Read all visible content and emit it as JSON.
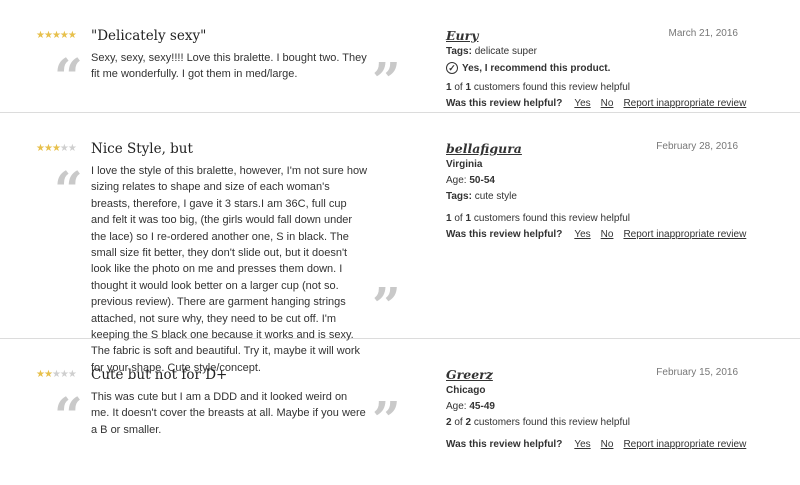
{
  "reviews": [
    {
      "rating": 5,
      "title": "\"Delicately sexy\"",
      "body": "Sexy, sexy, sexy!!!! Love this bralette. I bought two. They fit me wonderfully. I got them in med/large.",
      "author": "Eury",
      "date": "March 21, 2016",
      "tags_label": "Tags:",
      "tags": "delicate super",
      "recommend": "Yes, I recommend this product.",
      "helpful_count": "1",
      "helpful_of": "of",
      "helpful_total": "1",
      "helpful_suffix": "customers found this review helpful",
      "question": "Was this review helpful?",
      "yes": "Yes",
      "no": "No",
      "report": "Report inappropriate review"
    },
    {
      "rating": 3,
      "title": "Nice Style, but",
      "body": "I love the style of this bralette, however, I'm not sure how sizing relates to shape and size of each woman's breasts, therefore, I gave it 3 stars.I am 36C, full cup and felt it was too big, (the girls would fall down under the lace) so I re-ordered another one, S in black. The small size fit better, they don't slide out, but it doesn't look like the photo on me and presses them down. I thought it would look better on a larger cup (not so. previous review). There are garment hanging strings attached, not sure why, they need to be cut off. I'm keeping the S black one because it works and is sexy. The fabric is soft and beautiful. Try it, maybe it will work for your shape. Cute style/concept.",
      "author": "bellafigura",
      "date": "February 28, 2016",
      "location": "Virginia",
      "age_label": "Age:",
      "age": "50-54",
      "tags_label": "Tags:",
      "tags": "cute style",
      "helpful_count": "1",
      "helpful_of": "of",
      "helpful_total": "1",
      "helpful_suffix": "customers found this review helpful",
      "question": "Was this review helpful?",
      "yes": "Yes",
      "no": "No",
      "report": "Report inappropriate review"
    },
    {
      "rating": 2,
      "title": "Cute but not for D+",
      "body": "This was cute but I am a DDD and it looked weird on me. It doesn't cover the breasts at all. Maybe if you were a B or smaller.",
      "author": "Greerz",
      "date": "February 15, 2016",
      "location": "Chicago",
      "age_label": "Age:",
      "age": "45-49",
      "helpful_count": "2",
      "helpful_of": "of",
      "helpful_total": "2",
      "helpful_suffix": "customers found this review helpful",
      "question": "Was this review helpful?",
      "yes": "Yes",
      "no": "No",
      "report": "Report inappropriate review"
    }
  ],
  "colors": {
    "star_on": "#e7c04c",
    "star_off": "#cfcfcf",
    "quote": "#c9c9c9",
    "divider": "#dcdcdc"
  },
  "icons": {
    "star": "star-icon",
    "check": "check-circle-icon",
    "quote_open": "open-quote-icon",
    "quote_close": "close-quote-icon"
  }
}
